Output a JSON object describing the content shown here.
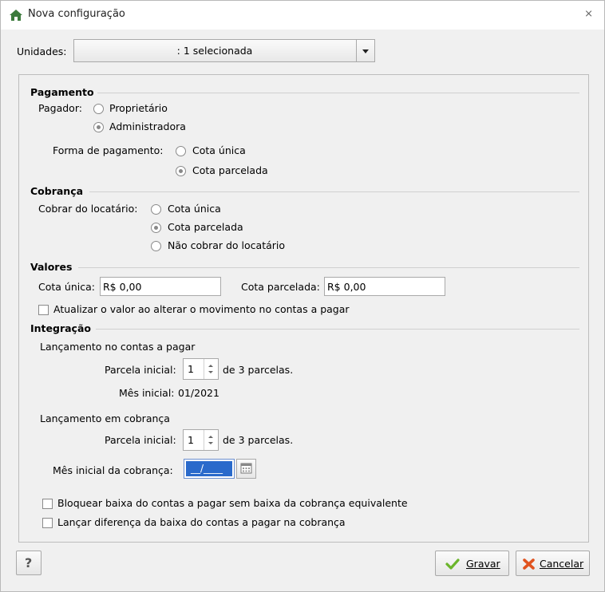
{
  "window": {
    "title": "Nova configuração"
  },
  "unidades": {
    "label": "Unidades:",
    "value": ": 1 selecionada"
  },
  "pagamento": {
    "title": "Pagamento",
    "pagador_label": "Pagador:",
    "pagador_options": [
      "Proprietário",
      "Administradora"
    ],
    "forma_label": "Forma de pagamento:",
    "forma_options": [
      "Cota única",
      "Cota parcelada"
    ]
  },
  "cobranca": {
    "title": "Cobrança",
    "cobrar_label": "Cobrar do locatário:",
    "options": [
      "Cota única",
      "Cota parcelada",
      "Não cobrar do locatário"
    ]
  },
  "valores": {
    "title": "Valores",
    "cota_unica_label": "Cota única:",
    "cota_unica_value": "R$ 0,00",
    "cota_parcelada_label": "Cota parcelada:",
    "cota_parcelada_value": "R$ 0,00",
    "atualizar_label": "Atualizar o valor ao alterar o movimento no contas a pagar"
  },
  "integracao": {
    "title": "Integração",
    "contas_pagar_title": "Lançamento no contas a pagar",
    "parcela_inicial_label": "Parcela inicial:",
    "parcela_inicial_value": "1",
    "parcelas_text": "de 3 parcelas.",
    "mes_inicial_label": "Mês inicial:",
    "mes_inicial_value": "01/2021",
    "cobranca_title": "Lançamento em cobrança",
    "parcela_inicial_cob_label": "Parcela inicial:",
    "parcela_inicial_cob_value": "1",
    "parcelas_cob_text": "de 3 parcelas.",
    "mes_cobranca_label": "Mês inicial da cobrança:",
    "mes_cobranca_value": "__/____",
    "bloquear_label": "Bloquear baixa do contas a pagar sem baixa da cobrança equivalente",
    "lancar_label": "Lançar diferença da baixa do contas a pagar na cobrança"
  },
  "buttons": {
    "help": "?",
    "gravar": "Gravar",
    "cancelar": "Cancelar"
  }
}
